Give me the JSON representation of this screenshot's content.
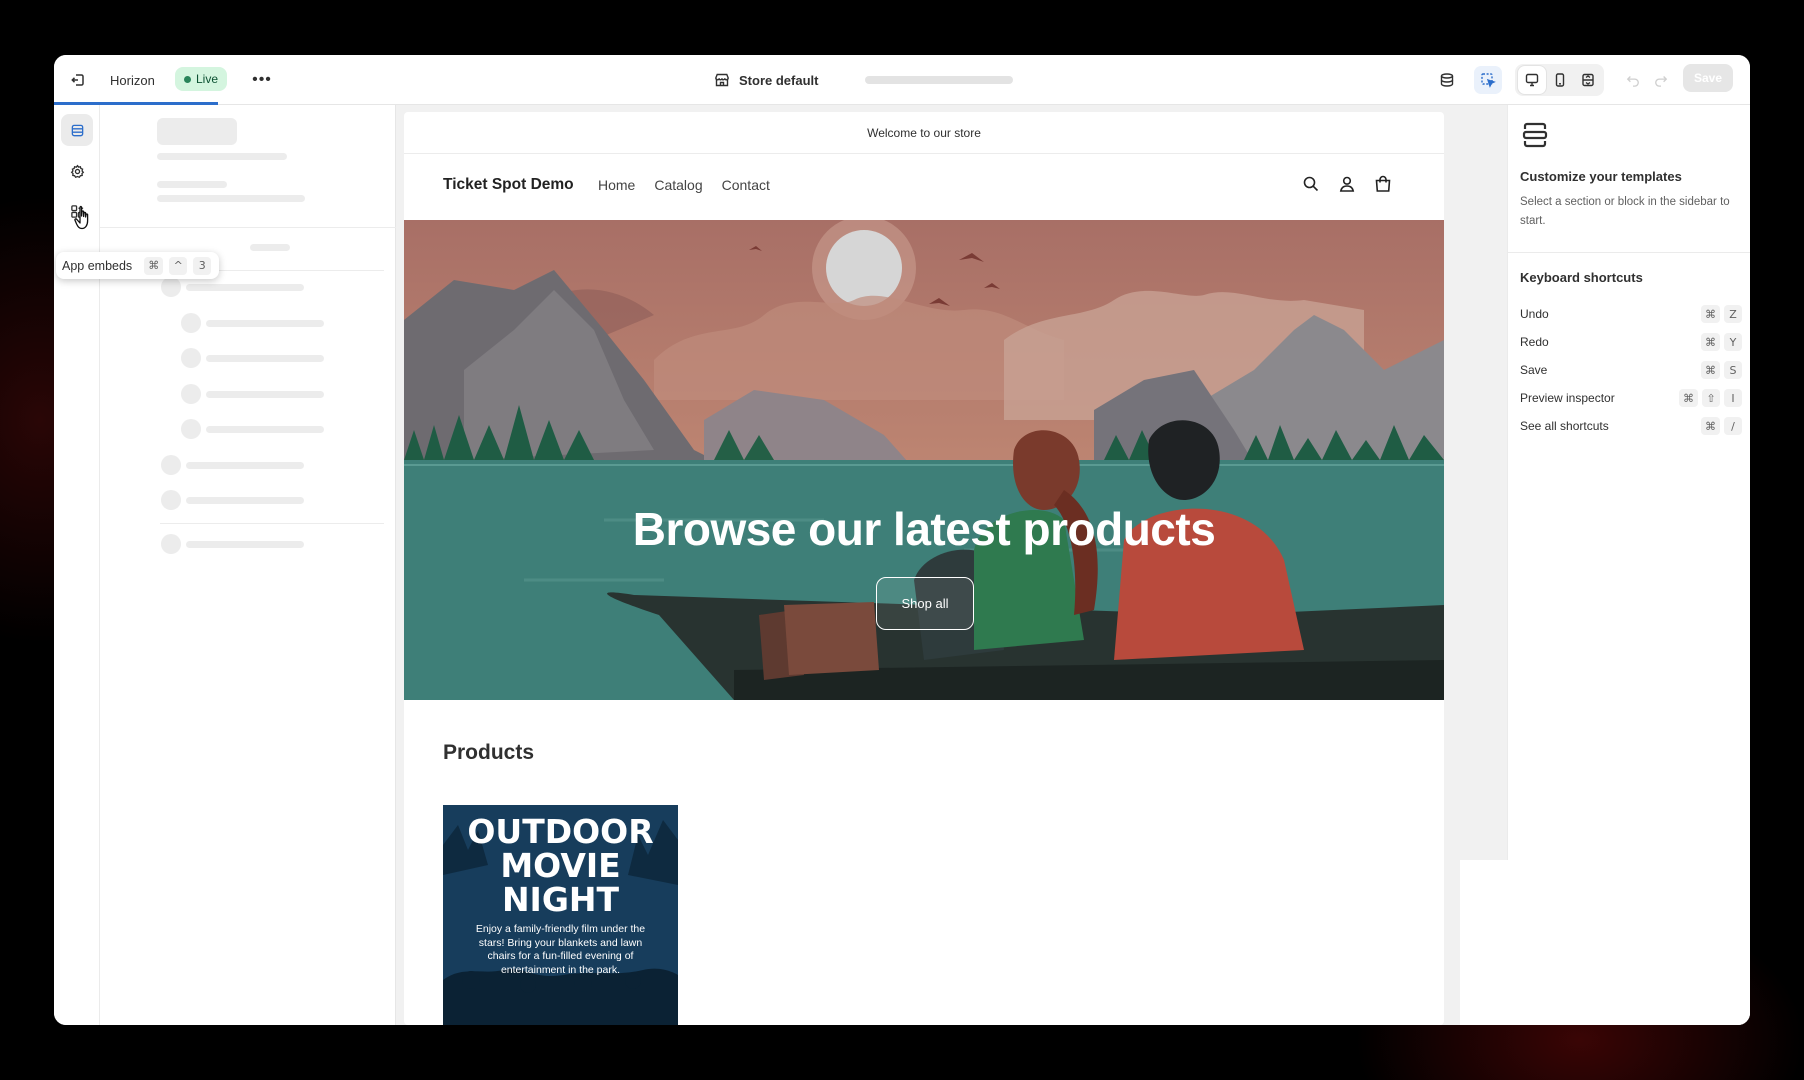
{
  "topbar": {
    "theme_name": "Horizon",
    "status_badge": "Live",
    "more_label": "•••",
    "store_selector": "Store default",
    "save_label": "Save"
  },
  "rail": {
    "tooltip": {
      "label": "App embeds",
      "keys": [
        "⌘",
        "^",
        "3"
      ]
    }
  },
  "preview": {
    "announcement": "Welcome to our store",
    "logo": "Ticket Spot Demo",
    "nav": [
      "Home",
      "Catalog",
      "Contact"
    ],
    "hero": {
      "title": "Browse our latest products",
      "button": "Shop all"
    },
    "products_title": "Products",
    "product_card": {
      "title_lines": [
        "OUTDOOR",
        "MOVIE",
        "NIGHT"
      ],
      "description": "Enjoy a family-friendly film under the stars! Bring your blankets and lawn chairs for a fun-filled evening of entertainment in the park."
    }
  },
  "right_panel": {
    "title": "Customize your templates",
    "description": "Select a section or block in the sidebar to start.",
    "shortcuts_title": "Keyboard shortcuts",
    "shortcuts": [
      {
        "label": "Undo",
        "keys": [
          "⌘",
          "Z"
        ]
      },
      {
        "label": "Redo",
        "keys": [
          "⌘",
          "Y"
        ]
      },
      {
        "label": "Save",
        "keys": [
          "⌘",
          "S"
        ]
      },
      {
        "label": "Preview inspector",
        "keys": [
          "⌘",
          "⇧",
          "I"
        ]
      },
      {
        "label": "See all shortcuts",
        "keys": [
          "⌘",
          "/"
        ]
      }
    ]
  },
  "colors": {
    "live_badge_bg": "#d4f5df",
    "accent": "#2c6ecb",
    "hero_sky": "#c98770",
    "hero_water": "#3e7f78",
    "product_card_bg": "#173d5c"
  }
}
